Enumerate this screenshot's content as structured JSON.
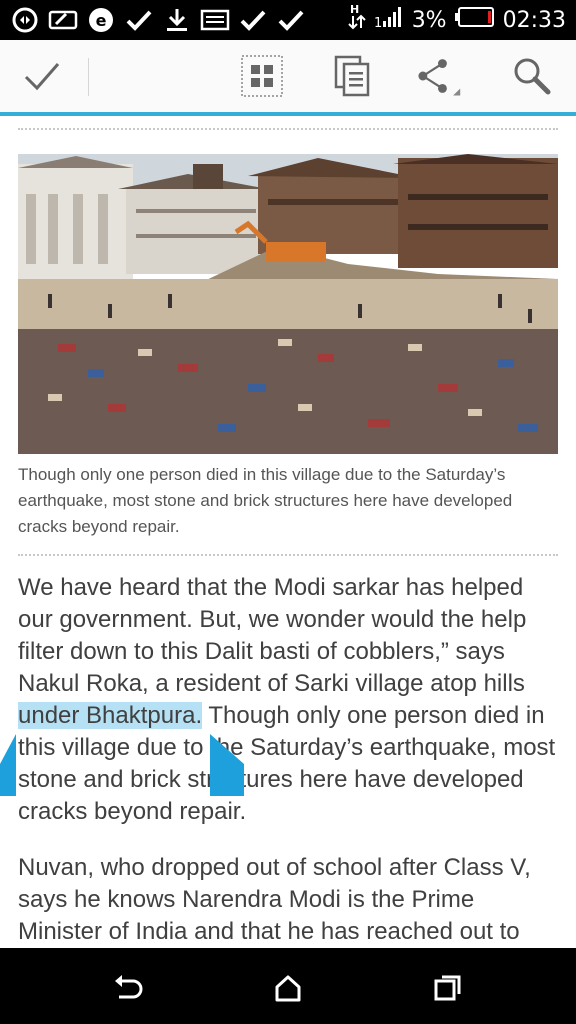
{
  "status_bar": {
    "battery_percent": "3%",
    "time": "02:33",
    "battery_color": "#e02020"
  },
  "toolbar": {
    "icons": [
      "check-icon",
      "grid-icon",
      "copy-icon",
      "share-icon",
      "search-icon"
    ]
  },
  "article": {
    "caption": "Though only one person died in this village due to the Saturday’s earthquake, most stone and brick structures here have developed cracks beyond repair.",
    "para1_before": "We have heard that the Modi sarkar has helped our government. But, we wonder would the help filter down to this Dalit basti of cobblers,” says Nakul Roka, a resident of Sarki village atop hills ",
    "para1_highlight": "under Bhaktpura.",
    "para1_after": " Though only one person died in this village due to the Saturday’s earthquake, most stone and brick structures here have developed cracks beyond repair.",
    "para2": "Nuvan, who dropped out of school after Class V, says he knows Narendra Modi is the Prime Minister of India and that he has reached out to"
  },
  "colors": {
    "accent": "#35aed8",
    "selection": "#b6e0f3",
    "handle": "#1ea0dc"
  }
}
